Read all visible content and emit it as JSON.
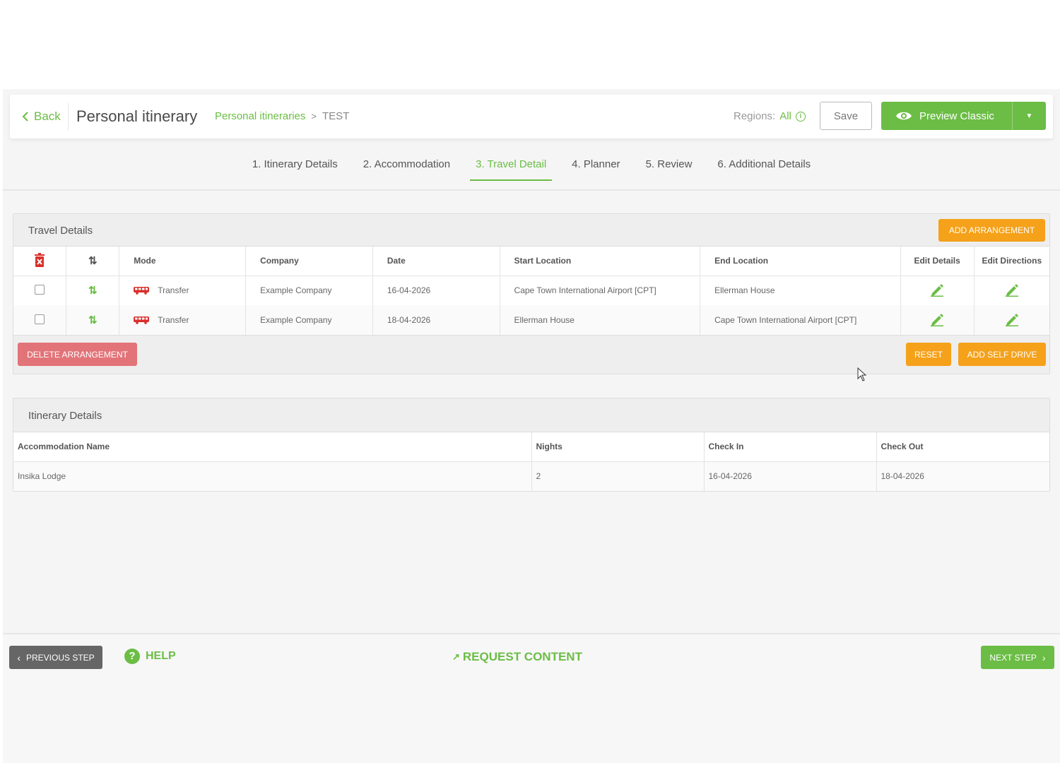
{
  "header": {
    "back_label": "Back",
    "title": "Personal itinerary",
    "breadcrumb_parent": "Personal itineraries",
    "breadcrumb_sep": ">",
    "breadcrumb_current": "TEST",
    "regions_label": "Regions:",
    "regions_value": "All",
    "save_label": "Save",
    "preview_label": "Preview Classic"
  },
  "tabs": [
    {
      "label": "1. Itinerary Details"
    },
    {
      "label": "2. Accommodation"
    },
    {
      "label": "3. Travel Detail",
      "active": true
    },
    {
      "label": "4. Planner"
    },
    {
      "label": "5. Review"
    },
    {
      "label": "6. Additional Details"
    }
  ],
  "travel": {
    "title": "Travel Details",
    "add_arrangement_label": "ADD ARRANGEMENT",
    "columns": {
      "mode": "Mode",
      "company": "Company",
      "date": "Date",
      "start": "Start Location",
      "end": "End Location",
      "edit_details": "Edit Details",
      "edit_directions": "Edit Directions"
    },
    "rows": [
      {
        "mode": "Transfer",
        "company": "Example Company",
        "date": "16-04-2026",
        "start": "Cape Town International Airport [CPT]",
        "end": "Ellerman House"
      },
      {
        "mode": "Transfer",
        "company": "Example Company",
        "date": "18-04-2026",
        "start": "Ellerman House",
        "end": "Cape Town International Airport [CPT]"
      }
    ],
    "delete_label": "DELETE ARRANGEMENT",
    "reset_label": "RESET",
    "self_drive_label": "ADD SELF DRIVE"
  },
  "itinerary": {
    "title": "Itinerary Details",
    "columns": {
      "name": "Accommodation Name",
      "nights": "Nights",
      "check_in": "Check In",
      "check_out": "Check Out"
    },
    "rows": [
      {
        "name": "Insika Lodge",
        "nights": "2",
        "check_in": "16-04-2026",
        "check_out": "18-04-2026"
      }
    ]
  },
  "footer": {
    "previous_label": "PREVIOUS STEP",
    "help_label": "HELP",
    "request_label": "REQUEST CONTENT",
    "next_label": "NEXT STEP"
  },
  "colors": {
    "accent": "#6bbd45",
    "orange": "#f5a11a",
    "danger": "#e27378",
    "dark": "#666666"
  }
}
